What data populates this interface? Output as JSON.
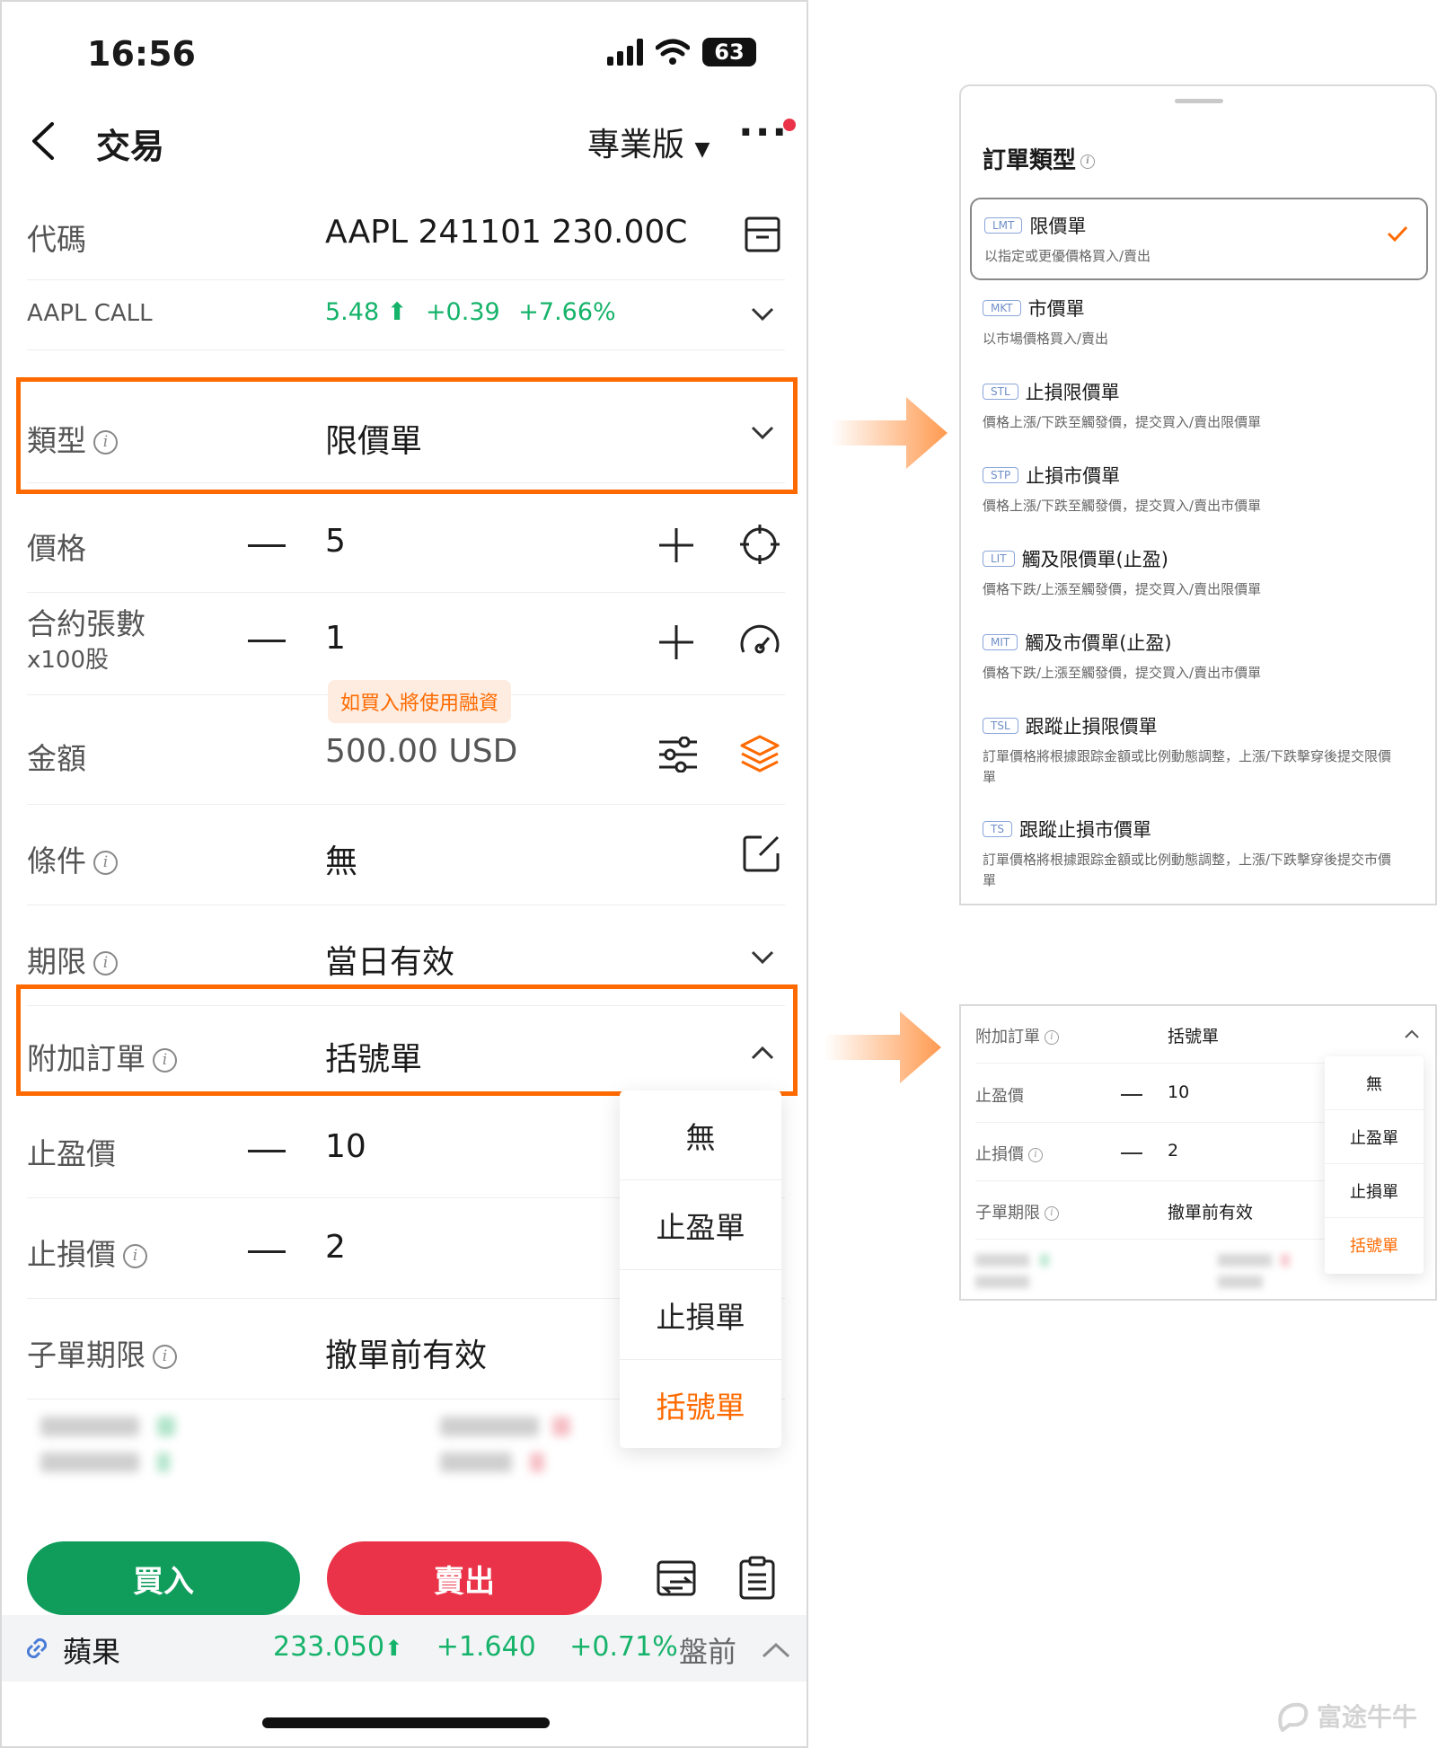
{
  "status_bar": {
    "time": "16:56",
    "battery": "63"
  },
  "nav": {
    "title": "交易",
    "edition": "專業版",
    "more": "···"
  },
  "symbol_row": {
    "label": "代碼",
    "value": "AAPL 241101 230.00C"
  },
  "quote_row": {
    "name": "AAPL CALL",
    "price": "5.48",
    "change": "+0.39",
    "pct": "+7.66%"
  },
  "type_row": {
    "label": "類型",
    "value": "限價單"
  },
  "price_row": {
    "label": "價格",
    "value": "5"
  },
  "qty_row": {
    "label": "合約張數",
    "sub_label": "x100股",
    "value": "1",
    "tooltip": "如買入將使用融資"
  },
  "amount_row": {
    "label": "金額",
    "value": "500.00 USD"
  },
  "condition_row": {
    "label": "條件",
    "value": "無"
  },
  "tif_row": {
    "label": "期限",
    "value": "當日有效"
  },
  "attach_row": {
    "label": "附加訂單",
    "value": "括號單"
  },
  "take_profit_row": {
    "label": "止盈價",
    "value": "10"
  },
  "stop_loss_row": {
    "label": "止損價",
    "value": "2"
  },
  "child_tif_row": {
    "label": "子單期限",
    "value": "撤單前有效"
  },
  "attach_dropdown": {
    "options": [
      "無",
      "止盈單",
      "止損單",
      "括號單"
    ],
    "selected": "括號單"
  },
  "actions": {
    "buy": "買入",
    "sell": "賣出"
  },
  "bottom_quote": {
    "name": "蘋果",
    "price": "233.050",
    "change": "+1.640",
    "pct": "+0.71%",
    "session": "盤前"
  },
  "order_types_panel": {
    "title": "訂單類型",
    "items": [
      {
        "code": "LMT",
        "name": "限價單",
        "desc": "以指定或更優價格買入/賣出",
        "selected": true
      },
      {
        "code": "MKT",
        "name": "市價單",
        "desc": "以市場價格買入/賣出"
      },
      {
        "code": "STL",
        "name": "止損限價單",
        "desc": "價格上漲/下跌至觸發價，提交買入/賣出限價單"
      },
      {
        "code": "STP",
        "name": "止損市價單",
        "desc": "價格上漲/下跌至觸發價，提交買入/賣出市價單"
      },
      {
        "code": "LIT",
        "name": "觸及限價單(止盈)",
        "desc": "價格下跌/上漲至觸發價，提交買入/賣出限價單"
      },
      {
        "code": "MIT",
        "name": "觸及市價單(止盈)",
        "desc": "價格下跌/上漲至觸發價，提交買入/賣出市價單"
      },
      {
        "code": "TSL",
        "name": "跟蹤止損限價單",
        "desc": "訂單價格將根據跟踪金額或比例動態調整，上漲/下跌擊穿後提交限價單"
      },
      {
        "code": "TS",
        "name": "跟蹤止損市價單",
        "desc": "訂單價格將根據跟踪金額或比例動態調整，上漲/下跌擊穿後提交市價單"
      }
    ]
  },
  "bracket_panel": {
    "attach_label": "附加訂單",
    "attach_value": "括號單",
    "tp_label": "止盈價",
    "tp_value": "10",
    "sl_label": "止損價",
    "sl_value": "2",
    "child_label": "子單期限",
    "child_value": "撤單前有效",
    "options": [
      "無",
      "止盈單",
      "止損單",
      "括號單"
    ]
  },
  "watermark": "富途牛牛",
  "colors": {
    "accent": "#ff6a00",
    "up": "#16b36a",
    "buy": "#109d5c",
    "sell": "#ea3348"
  }
}
